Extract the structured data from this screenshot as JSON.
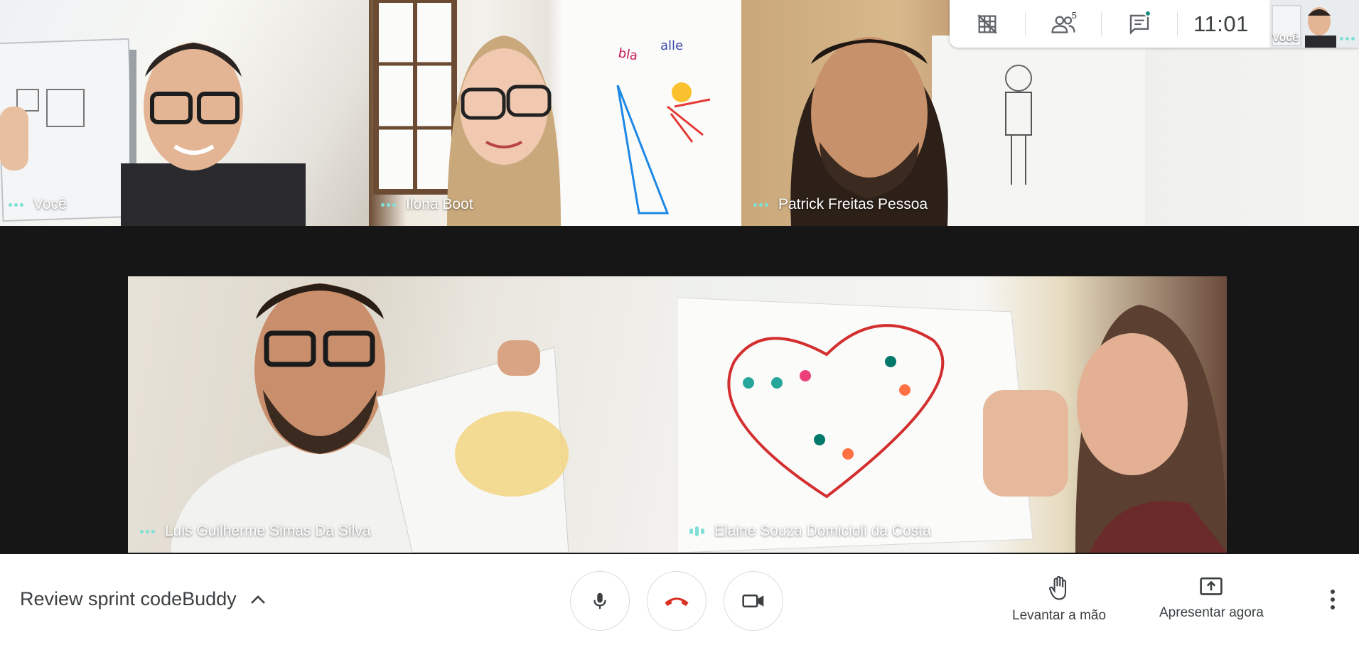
{
  "participants": [
    {
      "name": "Você"
    },
    {
      "name": "Ilona Boot"
    },
    {
      "name": "Patrick Freitas Pessoa"
    },
    {
      "name": "Luis Guilherme Simas Da Silva"
    },
    {
      "name": "Elaine Souza Domicioli da Costa"
    }
  ],
  "topbar": {
    "participant_count": "5",
    "time": "11:01",
    "self_label": "Você",
    "icons": [
      "grid-off-icon",
      "people-icon",
      "chat-icon"
    ]
  },
  "bottombar": {
    "meeting_title": "Review sprint codeBuddy",
    "raise_hand_label": "Levantar a mão",
    "present_label": "Apresentar agora",
    "icons": [
      "chevron-up-icon",
      "mic-icon",
      "hangup-icon",
      "camera-icon",
      "hand-icon",
      "present-icon",
      "more-vert-icon"
    ]
  },
  "colors": {
    "accent_teal": "#7ee0d6",
    "hangup_red": "#d93025",
    "stage_bg": "#161616",
    "text_dark": "#3c4043"
  }
}
